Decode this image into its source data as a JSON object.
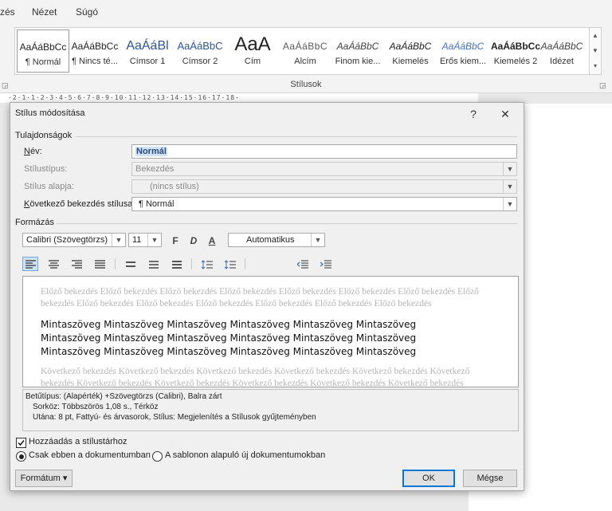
{
  "menu": {
    "items": [
      "zés",
      "Nézet",
      "Súgó"
    ]
  },
  "styles_gallery": {
    "group_label": "Stílusok",
    "items": [
      {
        "sample": "AaÁáBbCc",
        "name": "¶ Normál",
        "color": "#000000"
      },
      {
        "sample": "AaÁáBbCc",
        "name": "¶ Nincs té...",
        "color": "#000000"
      },
      {
        "sample": "AaÁáBl",
        "name": "Címsor 1",
        "color": "#2f5496"
      },
      {
        "sample": "AaÁáBbC",
        "name": "Címsor 2",
        "color": "#2f5496"
      },
      {
        "sample": "AaA",
        "name": "Cím",
        "color": "#000000"
      },
      {
        "sample": "AaÁáBbC",
        "name": "Alcím",
        "color": "#5a5a5a"
      },
      {
        "sample": "AaÁáBbC",
        "name": "Finom kie...",
        "color": "#404040"
      },
      {
        "sample": "AaÁáBbC",
        "name": "Kiemelés",
        "color": "#000000"
      },
      {
        "sample": "AaÁáBbC",
        "name": "Erős kiem...",
        "color": "#4472c4"
      },
      {
        "sample": "AaÁáBbCc",
        "name": "Kiemelés 2",
        "color": "#000000"
      },
      {
        "sample": "AaÁáBbC",
        "name": "Idézet",
        "color": "#404040"
      }
    ]
  },
  "ruler": {
    "text": "·2·1·1·2·3·4·5·6·7·8·9·10·11·12·13·14·15·16·17·18·"
  },
  "dialog": {
    "title": "Stílus módosítása",
    "help": "?",
    "close": "✕",
    "properties_section": "Tulajdonságok",
    "name_label_u": "N",
    "name_label_rest": "év:",
    "name_value": "Normál",
    "type_label": "Stílustípus:",
    "type_value": "Bekezdés",
    "based_label": "Stílus alapja:",
    "based_value": "(nincs stílus)",
    "next_label_u": "K",
    "next_label_rest": "övetkező bekezdés stílusa:",
    "next_value": "¶  Normál",
    "formatting_section": "Formázás",
    "font_value": "Calibri (Szövegtörzs)",
    "size_value": "11",
    "bold": "F",
    "italic": "D",
    "underline": "A",
    "color_value": "Automatikus",
    "preview": {
      "previous": "Előző bekezdés Előző bekezdés Előző bekezdés Előző bekezdés Előző bekezdés Előző bekezdés Előző bekezdés Előző bekezdés Előző bekezdés Előző bekezdés Előző bekezdés Előző bekezdés Előző bekezdés Előző bekezdés",
      "sample": "Mintaszöveg Mintaszöveg Mintaszöveg Mintaszöveg Mintaszöveg Mintaszöveg Mintaszöveg Mintaszöveg Mintaszöveg Mintaszöveg Mintaszöveg Mintaszöveg Mintaszöveg Mintaszöveg Mintaszöveg Mintaszöveg Mintaszöveg Mintaszöveg",
      "next": "Következő bekezdés Következő bekezdés Következő bekezdés Következő bekezdés Következő bekezdés Következő bekezdés Következő bekezdés Következő bekezdés Következő bekezdés Következő bekezdés Következő bekezdés Következő bekezdés"
    },
    "description": {
      "line1": "Betűtípus: (Alapérték) +Szövegtörzs (Calibri), Balra zárt",
      "line2": "Sorköz:  Többszörös 1,08 s., Térköz",
      "line3": "Utána: 8 pt, Fattyú- és árvasorok, Stílus: Megjelenítés a Stílusok gyűjteményben"
    },
    "add_to_gallery": "Hozzáadás a stílustárhoz",
    "add_to_gallery_checked": true,
    "radio_doc_only": "Csak ebben a dokumentumban",
    "radio_template": "A sablonon alapuló új dokumentumokban",
    "format_button": "Formátum ▾",
    "ok_button": "OK",
    "cancel_button": "Mégse"
  }
}
